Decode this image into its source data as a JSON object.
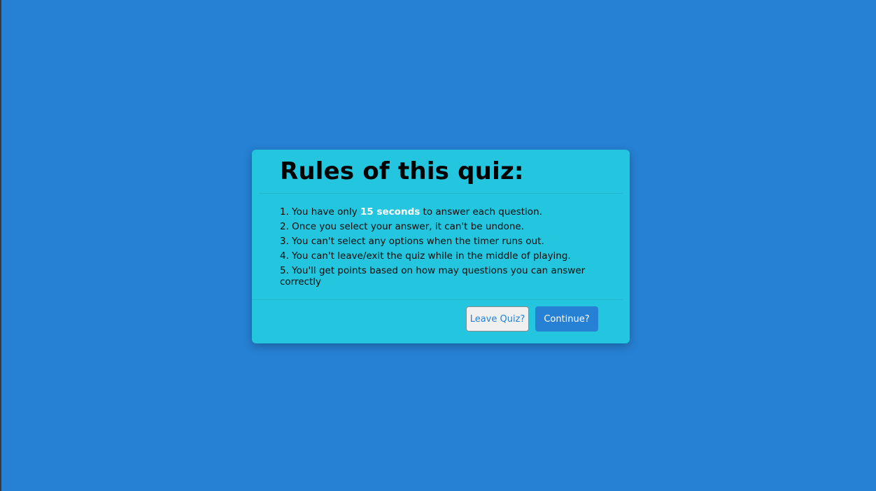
{
  "dialog": {
    "title": "Rules of this quiz:",
    "rules": [
      {
        "prefix": "1. You have only ",
        "highlight": "15 seconds",
        "suffix": " to answer each question."
      },
      {
        "text": "2. Once you select your answer, it can't be undone."
      },
      {
        "text": "3. You can't select any options when the timer runs out."
      },
      {
        "text": "4. You can't leave/exit the quiz while in the middle of playing."
      },
      {
        "text": "5. You'll get points based on how may questions you can answer correctly"
      }
    ],
    "leave_label": "Leave Quiz?",
    "continue_label": "Continue?"
  },
  "colors": {
    "background": "#2680d3",
    "dialog": "#23c6de",
    "highlight": "#ffffff",
    "primary_button": "#2680d3"
  }
}
